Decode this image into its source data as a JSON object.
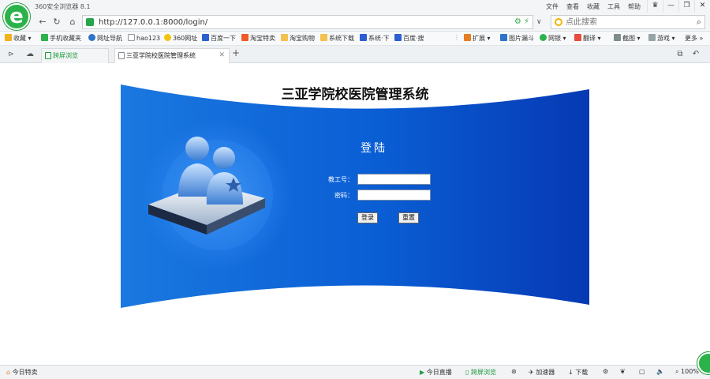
{
  "browser": {
    "app_title": "360安全浏览器 8.1",
    "menu": [
      "文件",
      "查看",
      "收藏",
      "工具",
      "帮助"
    ],
    "address": "http://127.0.0.1:8000/login/",
    "search_placeholder": "点此搜索",
    "bookmarks": [
      "收藏",
      "手机收藏夹",
      "网址导航",
      "hao123",
      "360网址",
      "百度一下",
      "淘宝特卖",
      "淘宝购物",
      "系统下载",
      "系统·下",
      "百度·搜",
      "扩展",
      "图片漏斗",
      "网银",
      "翻译",
      "截图",
      "游戏",
      "更多"
    ],
    "tabs": [
      {
        "label": "跨屏浏览"
      },
      {
        "label": "三亚学院校医院管理系统"
      }
    ]
  },
  "page": {
    "title": "三亚学院校医院管理系统",
    "login_heading": "登陆",
    "employee_id_label": "教工号：",
    "password_label": "密码：",
    "login_button": "登录",
    "reset_button": "重置"
  },
  "statusbar": {
    "left": "今日特卖",
    "live": "今日直播",
    "cross_screen": "跨屏浏览",
    "accelerator": "加速器",
    "download": "下载",
    "zoom": "100%"
  }
}
